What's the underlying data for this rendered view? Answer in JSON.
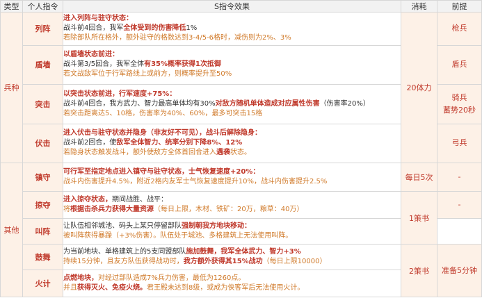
{
  "headers": [
    "类型",
    "个人指令",
    "S指令效果",
    "消耗",
    "前提"
  ],
  "categories": {
    "army": "兵种",
    "other": "其他"
  },
  "costs": {
    "army_shared": "20体力",
    "zhenshou": "每日5次",
    "ce1": "1策书",
    "ce2": "2策书"
  },
  "prereqs": {
    "liezhen": "枪兵",
    "dunqiang": "盾兵",
    "tuji_1": "骑兵",
    "tuji_2": "蓄势20秒",
    "fuji": "弓兵",
    "zhenshou": "-",
    "lueduo": "-",
    "guwu_huoji": "准备5分钟"
  },
  "rows": {
    "liezhen": {
      "name": "列阵",
      "head": "进入列阵与驻守状态：",
      "l1a": "战斗前4回合，我军",
      "l1b": "全体受到的伤害降低",
      "l1c": "1%",
      "l2": "若除部队所在格外，额外驻守的格数达到3-4/5-6格时，减伤则为2%、3%"
    },
    "dunqiang": {
      "name": "盾墙",
      "head": "以盾墙状态前进：",
      "l1a": "战斗第3/5回合，我军全体",
      "l1b": "有35%概率获得1次抵御",
      "l2": "若文战敌军位于行军路线上或前方，则概率提升至50%"
    },
    "tuji": {
      "name": "突击",
      "head": "以突击状态前进，",
      "head_b": "行军速度+75%：",
      "l1a": "战斗前4回合，我方武力、智力最高单体均有30%",
      "l1b": "对敌方随机单体造成对应属性伤害",
      "l1c": "（伤害率20%）",
      "l2": "若突击距离达5、10格，伤害率为40%、60%，最多可突击15格"
    },
    "fuji": {
      "name": "伏击",
      "head": "进入伏击与驻守状态并隐身（非友好不可见），",
      "head_b": "战斗后解除隐身：",
      "l1a": "战斗前2回合，使",
      "l1b": "敌军全体智力、统率分别下降8%、12%",
      "l2a": "若隐身状态触发战斗，额外使敌方全体首回合进入",
      "l2b": "遇袭",
      "l2c": "状态。"
    },
    "zhenshou": {
      "name": "镇守",
      "head": "可行军至指定地点进入镇守与驻守状态，士气恢复速度+20%：",
      "l1": "战斗内伤害提升4.5%，附近2格内友军士气恢复速度提升10%，战斗内伤害提升2.5%"
    },
    "lueduo": {
      "name": "掠夺",
      "head": "进入掠夺状态，",
      "head_b": "期间战胜、战平：",
      "l1a": "将",
      "l1b": "根据击杀兵力获得大量资源",
      "l1c": "（每日上限，木材、铁矿：20万，粮草：40万）"
    },
    "jiaozhen": {
      "name": "叫阵",
      "l1a": "让队伍相邻城池、码头上某只停留部队",
      "l1b": "强制朝我方地块移动：",
      "l2": "被叫阵获得暴躁（+3%伤害）。队伍处于城池、多格建筑上无法使用叫阵。"
    },
    "guwu": {
      "name": "鼓舞",
      "l1a": "为当前地块、单格建筑上的5支同盟部队",
      "l1b": "施加鼓舞，我军全体武力、智力+3%",
      "l2": "持续15分钟，且友方队伍获得战功时，",
      "l2b": "我方额外获得其15%战功",
      "l2c": "（每日上限10000）"
    },
    "huoji": {
      "name": "火计",
      "head": "点燃地块，",
      "head_b": "对经过部队造成7%兵力伤害，最低为1260点。",
      "l1a": "并且",
      "l1b": "获得灭火、免疫火烧。",
      "l1c": "君王殿未达到8级，或成为侠客军后无法使用火计。"
    }
  }
}
